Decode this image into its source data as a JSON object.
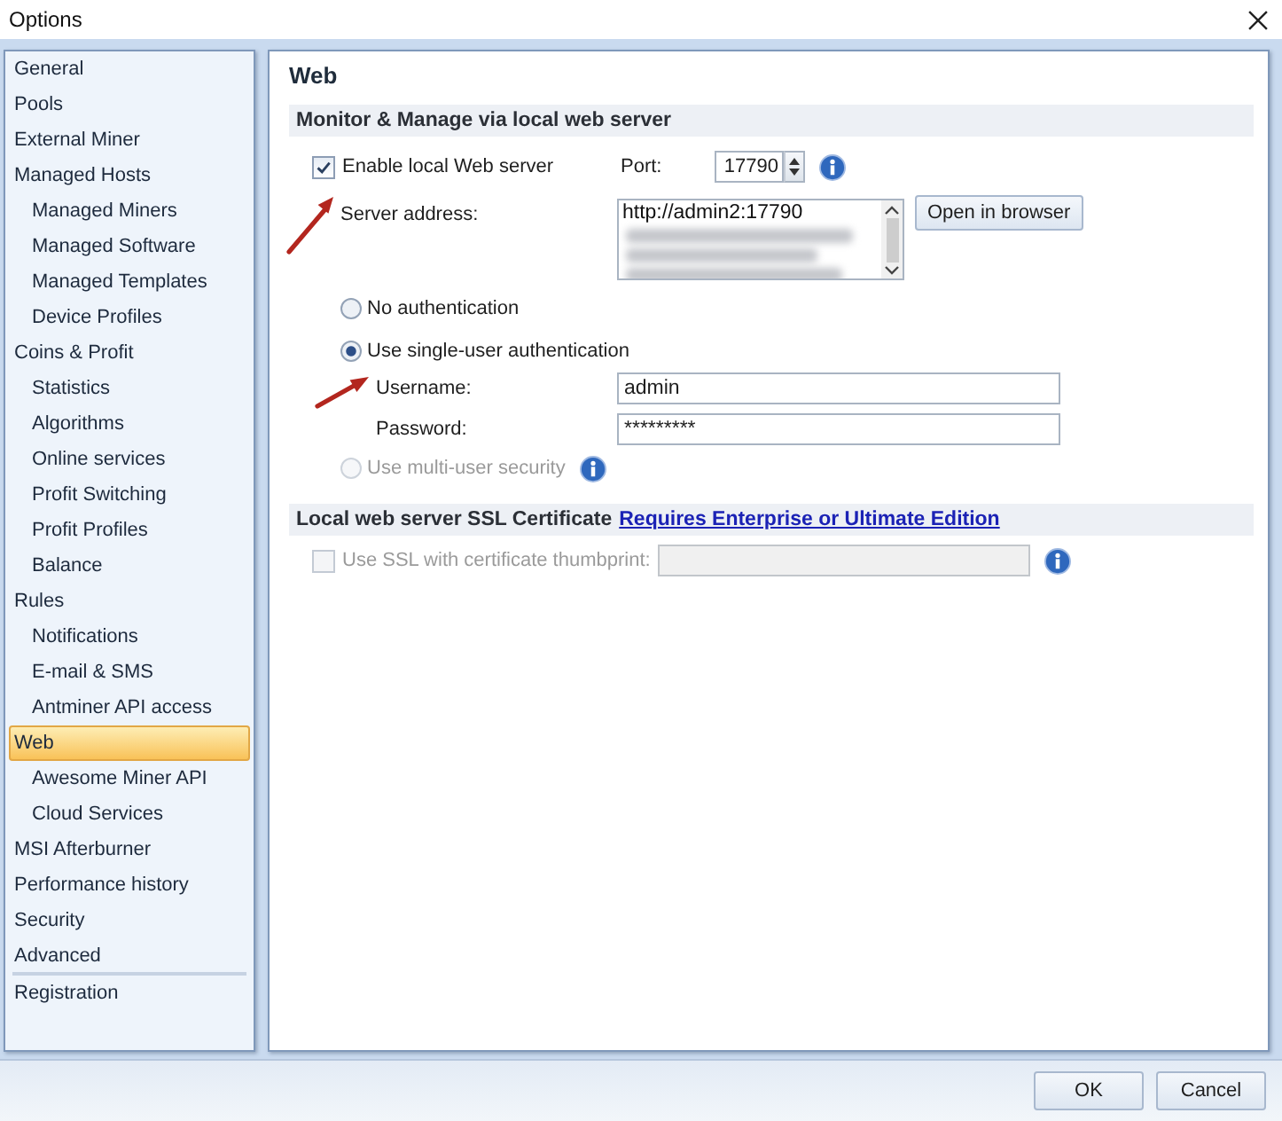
{
  "window": {
    "title": "Options"
  },
  "sidebar": {
    "items": [
      {
        "label": "General",
        "selected": false
      },
      {
        "label": "Pools",
        "selected": false
      },
      {
        "label": "External Miner",
        "selected": false
      },
      {
        "label": "Managed Hosts",
        "selected": false,
        "children": [
          {
            "label": "Managed Miners",
            "selected": false
          },
          {
            "label": "Managed Software",
            "selected": false
          },
          {
            "label": "Managed Templates",
            "selected": false
          },
          {
            "label": "Device Profiles",
            "selected": false
          }
        ]
      },
      {
        "label": "Coins & Profit",
        "selected": false,
        "children": [
          {
            "label": "Statistics",
            "selected": false
          },
          {
            "label": "Algorithms",
            "selected": false
          },
          {
            "label": "Online services",
            "selected": false
          },
          {
            "label": "Profit Switching",
            "selected": false
          },
          {
            "label": "Profit Profiles",
            "selected": false
          },
          {
            "label": "Balance",
            "selected": false
          }
        ]
      },
      {
        "label": "Rules",
        "selected": false,
        "children": [
          {
            "label": "Notifications",
            "selected": false
          },
          {
            "label": "E-mail & SMS",
            "selected": false
          },
          {
            "label": "Antminer API access",
            "selected": false
          }
        ]
      },
      {
        "label": "Web",
        "selected": true,
        "children": [
          {
            "label": "Awesome Miner API",
            "selected": false
          },
          {
            "label": "Cloud Services",
            "selected": false
          }
        ]
      },
      {
        "label": "MSI Afterburner",
        "selected": false
      },
      {
        "label": "Performance history",
        "selected": false
      },
      {
        "label": "Security",
        "selected": false
      },
      {
        "label": "Advanced",
        "selected": false
      }
    ],
    "footer_items": [
      {
        "label": "Registration",
        "selected": false
      }
    ]
  },
  "page": {
    "title": "Web"
  },
  "web_server": {
    "header": "Monitor & Manage via local web server",
    "enable": {
      "label": "Enable local Web server",
      "checked": true
    },
    "port": {
      "label": "Port:",
      "value": "17790"
    },
    "server_address": {
      "label": "Server address:",
      "items": [
        "http://admin2:17790"
      ]
    },
    "open_button": "Open in browser",
    "auth_options": [
      {
        "label": "No authentication",
        "selected": false,
        "disabled": false,
        "info": false
      },
      {
        "label": "Use single-user authentication",
        "selected": true,
        "disabled": false,
        "info": false,
        "fields": [
          {
            "label": "Username:",
            "value": "admin"
          },
          {
            "label": "Password:",
            "value": "*********"
          }
        ]
      },
      {
        "label": "Use multi-user security",
        "selected": false,
        "disabled": true,
        "info": true
      }
    ]
  },
  "ssl": {
    "header": "Local web server SSL Certificate",
    "link": "Requires Enterprise or Ultimate Edition",
    "use_ssl": {
      "label": "Use SSL with certificate thumbprint:",
      "checked": false,
      "disabled": true
    }
  },
  "buttons": [
    "OK",
    "Cancel"
  ]
}
